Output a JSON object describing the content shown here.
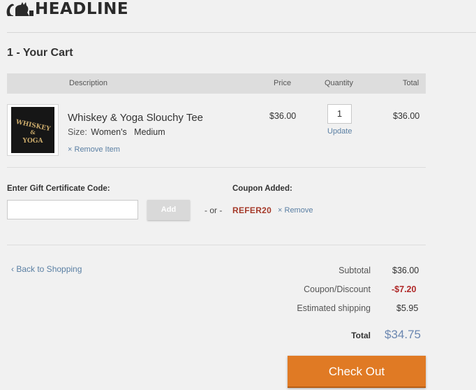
{
  "header": {
    "logo_text": "HEADLINE"
  },
  "cart": {
    "title": "1 - Your Cart",
    "columns": {
      "description": "Description",
      "price": "Price",
      "quantity": "Quantity",
      "total": "Total"
    },
    "item": {
      "name": "Whiskey & Yoga Slouchy Tee",
      "size_label": "Size:",
      "size_value": "Women's   Medium",
      "remove_label": "Remove Item",
      "price": "$36.00",
      "quantity": "1",
      "update_label": "Update",
      "line_total": "$36.00",
      "thumbnail_text": [
        "WHISKEY",
        "&",
        "YOGA"
      ]
    }
  },
  "gift": {
    "label": "Enter Gift Certificate Code:",
    "input_value": "",
    "add_label": "Add"
  },
  "or_text": "- or -",
  "coupon": {
    "label": "Coupon Added:",
    "code": "REFER20",
    "remove_label": "Remove"
  },
  "back_label": "‹ Back to Shopping",
  "summary": {
    "subtotal_label": "Subtotal",
    "subtotal": "$36.00",
    "discount_label": "Coupon/Discount",
    "discount": "-$7.20",
    "shipping_label": "Estimated shipping",
    "shipping": "$5.95",
    "total_label": "Total",
    "total": "$34.75"
  },
  "checkout_label": "Check Out",
  "colors": {
    "accent": "#e07a24",
    "link": "#5a7fa3",
    "discount": "#b02a2a",
    "total": "#6a86b0"
  },
  "icons": {
    "logo": "cat-silhouette-icon",
    "remove": "close-icon"
  }
}
